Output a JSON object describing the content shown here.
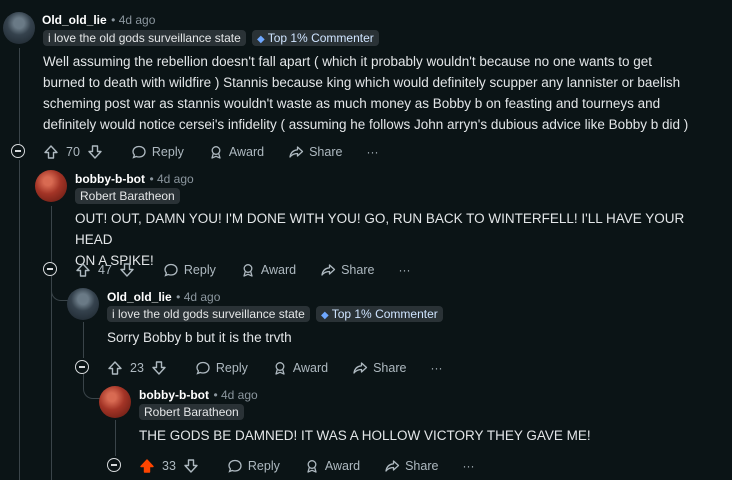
{
  "comments": [
    {
      "author": "Old_old_lie",
      "time": "4d ago",
      "flair": "i love the old gods surveillance state",
      "badge": "Top 1% Commenter",
      "text_lines": [
        "Well assuming the rebellion doesn't fall apart ( which it probably wouldn't because no one wants to get",
        "burned to death with wildfire ) Stannis because king which would definitely scupper any lannister or baelish",
        "scheming post war as stannis wouldn't waste as much money as Bobby b on feasting and tourneys and",
        "definitely would notice cersei's infidelity ( assuming he follows John arryn's dubious advice like Bobby b did )"
      ],
      "votes": "70"
    },
    {
      "author": "bobby-b-bot",
      "time": "4d ago",
      "flair": "Robert Baratheon",
      "text_lines": [
        "OUT! OUT, DAMN YOU! I'M DONE WITH YOU! GO, RUN BACK TO WINTERFELL! I'LL HAVE YOUR HEAD",
        "ON A SPIKE!"
      ],
      "votes": "47"
    },
    {
      "author": "Old_old_lie",
      "time": "4d ago",
      "flair": "i love the old gods surveillance state",
      "badge": "Top 1% Commenter",
      "text_lines": [
        "Sorry Bobby b but it is the trvth"
      ],
      "votes": "23"
    },
    {
      "author": "bobby-b-bot",
      "time": "4d ago",
      "flair": "Robert Baratheon",
      "text_lines": [
        "THE GODS BE DAMNED! IT WAS A HOLLOW VICTORY THEY GAVE ME!"
      ],
      "votes": "33",
      "upvoted": true
    }
  ],
  "actions": {
    "reply": "Reply",
    "award": "Award",
    "share": "Share",
    "more": "···"
  },
  "colors": {
    "upvote_active": "#ff4500",
    "background": "#0b1416"
  },
  "icons": [
    "collapse-icon",
    "upvote-icon",
    "downvote-icon",
    "reply-icon",
    "award-icon",
    "share-icon",
    "more-icon"
  ]
}
